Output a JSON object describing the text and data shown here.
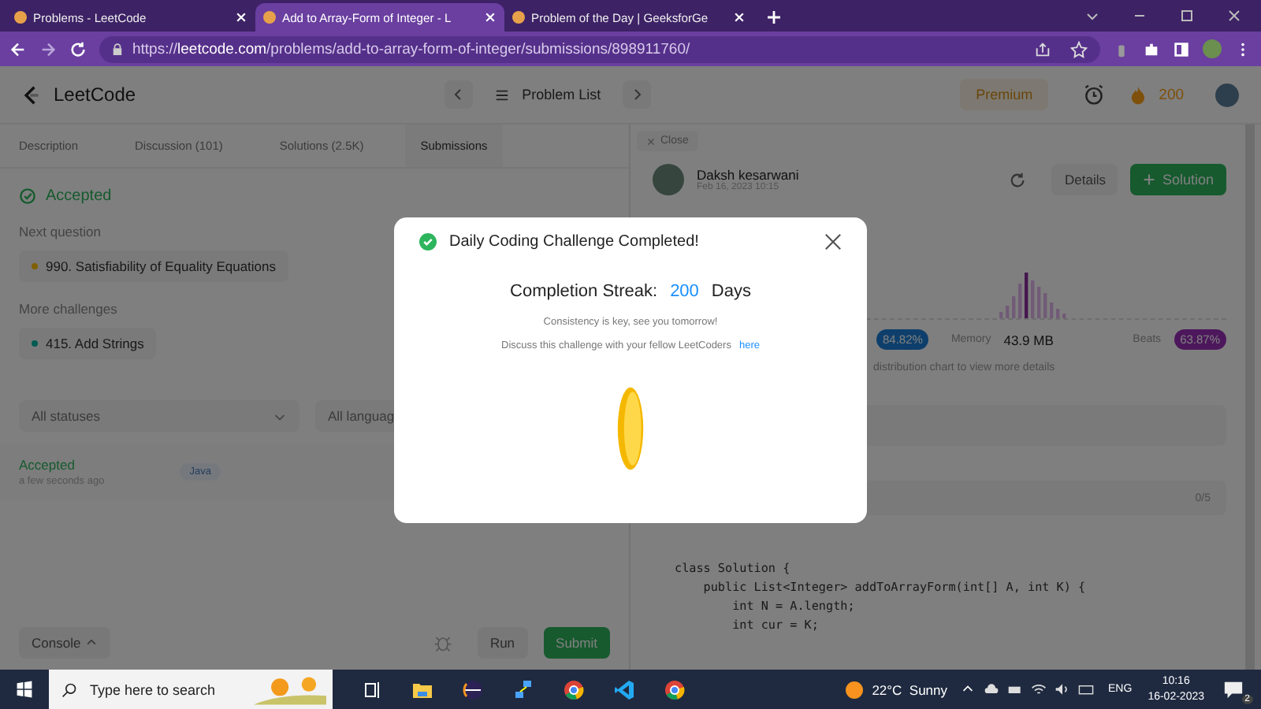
{
  "browser": {
    "tabs": [
      {
        "title": "Problems - LeetCode",
        "selected": false
      },
      {
        "title": "Add to Array-Form of Integer - L",
        "selected": true
      },
      {
        "title": "Problem of the Day | GeeksforGe",
        "selected": false
      }
    ],
    "url": "https://**leetcode.com**/problems/add-to-array-form-of-integer/submissions/898911760/"
  },
  "header": {
    "logo": "LeetCode",
    "problem_list": "Problem List",
    "premium": "Premium",
    "streak": "200"
  },
  "left": {
    "tabs": [
      {
        "label": "Description",
        "selected": false
      },
      {
        "label": "Discussion (101)",
        "selected": false
      },
      {
        "label": "Solutions (2.5K)",
        "selected": false
      },
      {
        "label": "Submissions",
        "selected": true
      }
    ],
    "status": "Accepted",
    "next_label": "Next question",
    "next_question": {
      "title": "990. Satisfiability of Equality Equations",
      "color": "#806000"
    },
    "more_label": "More challenges",
    "more": [
      {
        "title": "415. Add Strings",
        "color": "#005c52"
      }
    ],
    "filters": [
      "All statuses",
      "All languag"
    ],
    "submission": {
      "status": "Accepted",
      "time": "a few seconds ago",
      "language": "Java"
    },
    "console": "Console",
    "run": "Run",
    "submit": "Submit"
  },
  "right": {
    "close": "Close",
    "author": "Daksh kesarwani",
    "date": "Feb 16, 2023 10:15",
    "details": "Details",
    "solution": "Solution",
    "runtime_beats": "84.82%",
    "memory_label": "Memory",
    "memory": "43.9 MB",
    "beats_label": "Beats",
    "memory_beats": "63.87%",
    "hint": "distribution chart to view more details",
    "testcases": "0/5",
    "code": [
      "class Solution {",
      "    public List<Integer> addToArrayForm(int[] A, int K) {",
      "        int N = A.length;",
      "        int cur = K;"
    ]
  },
  "modal": {
    "title": "Daily Coding Challenge Completed!",
    "streak_label": "Completion Streak:",
    "streak_value": "200",
    "streak_unit": "Days",
    "message": "Consistency is key, see you tomorrow!",
    "discuss": "Discuss this challenge with your fellow LeetCoders",
    "link": "here"
  },
  "taskbar": {
    "search_placeholder": "Type here to search",
    "weather": "22°C  Sunny",
    "language": "ENG",
    "time": "10:16",
    "date": "16-02-2023",
    "notifications": "2"
  }
}
